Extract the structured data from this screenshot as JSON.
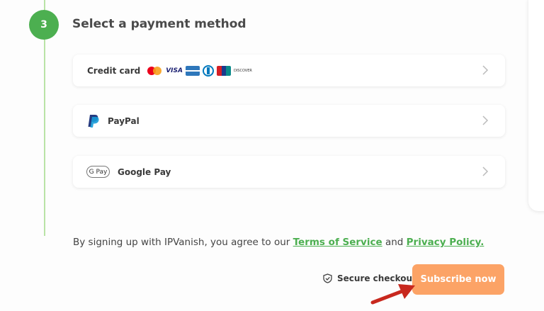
{
  "step": {
    "number": "3",
    "title": "Select a payment method"
  },
  "payment_options": [
    {
      "label": "Credit card",
      "icon": "credit-card-logos"
    },
    {
      "label": "PayPal",
      "icon": "paypal-icon"
    },
    {
      "label": "Google Pay",
      "icon": "google-pay-icon",
      "badge": "G Pay"
    }
  ],
  "card_brands": [
    "mastercard",
    "visa",
    "american-express",
    "diners-club",
    "unionpay",
    "discover"
  ],
  "visa_text": "VISA",
  "discover_text": "DISCOVER",
  "terms": {
    "prefix": "By signing up with IPVanish, you agree to our ",
    "tos_link": "Terms of Service",
    "middle": " and ",
    "privacy_link": "Privacy Policy."
  },
  "secure_checkout": "Secure checkout",
  "subscribe_button": "Subscribe now",
  "colors": {
    "step_badge": "#4caf50",
    "timeline": "#b9e3a6",
    "link": "#4caf50",
    "subscribe": "#fca366",
    "arrow": "#c8281e"
  }
}
